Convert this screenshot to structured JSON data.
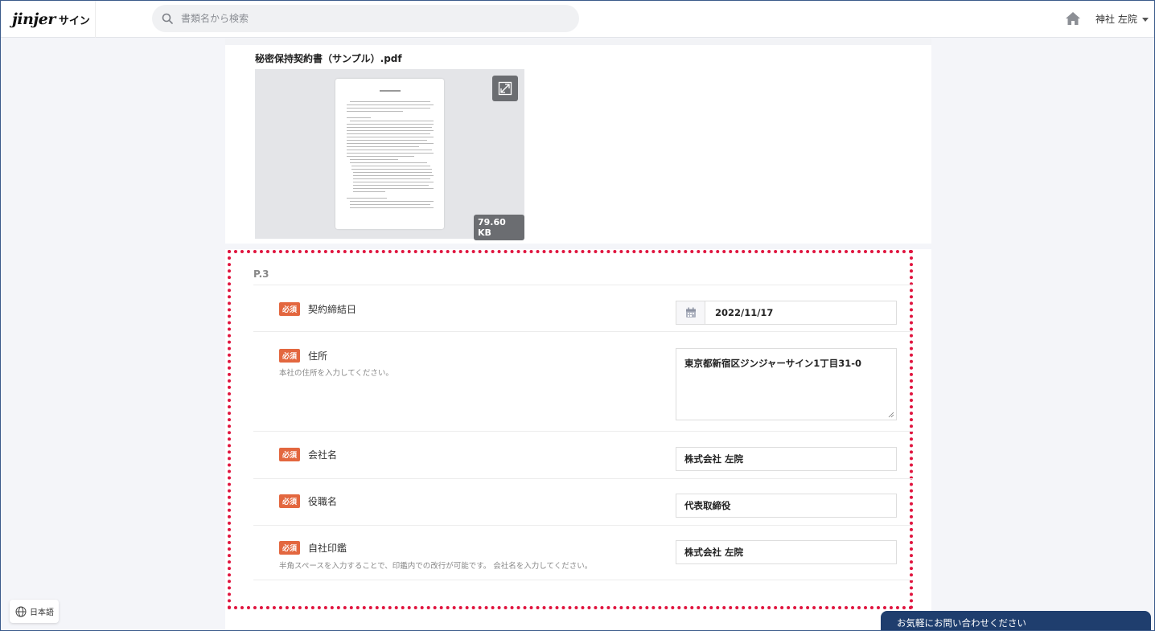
{
  "header": {
    "logo": "jinjer",
    "logo_sub": "サイン",
    "search_placeholder": "書類名から検索",
    "user_name": "神社 左院"
  },
  "document": {
    "file_name": "秘密保持契約書（サンプル）.pdf",
    "file_size": "79.60 KB"
  },
  "section": {
    "page_label": "P.3",
    "required_badge": "必須",
    "fields": [
      {
        "label": "契約締結日",
        "hint": "",
        "value": "2022/11/17",
        "type": "date"
      },
      {
        "label": "住所",
        "hint": "本社の住所を入力してください。",
        "value": "東京都新宿区ジンジャーサイン1丁目31-0",
        "type": "textarea"
      },
      {
        "label": "会社名",
        "hint": "",
        "value": "株式会社 左院",
        "type": "text"
      },
      {
        "label": "役職名",
        "hint": "",
        "value": "代表取締役",
        "type": "text"
      },
      {
        "label": "自社印鑑",
        "hint": "半角スペースを入力することで、印鑑内での改行が可能です。 会社名を入力してください。",
        "value": "株式会社 左院",
        "type": "text"
      }
    ]
  },
  "footer": {
    "language": "日本語",
    "contact": "お気軽にお問い合わせください"
  },
  "colors": {
    "required_badge": "#e3673f",
    "highlight_border": "#e0153f",
    "contact_bg": "#1f3e6e"
  }
}
